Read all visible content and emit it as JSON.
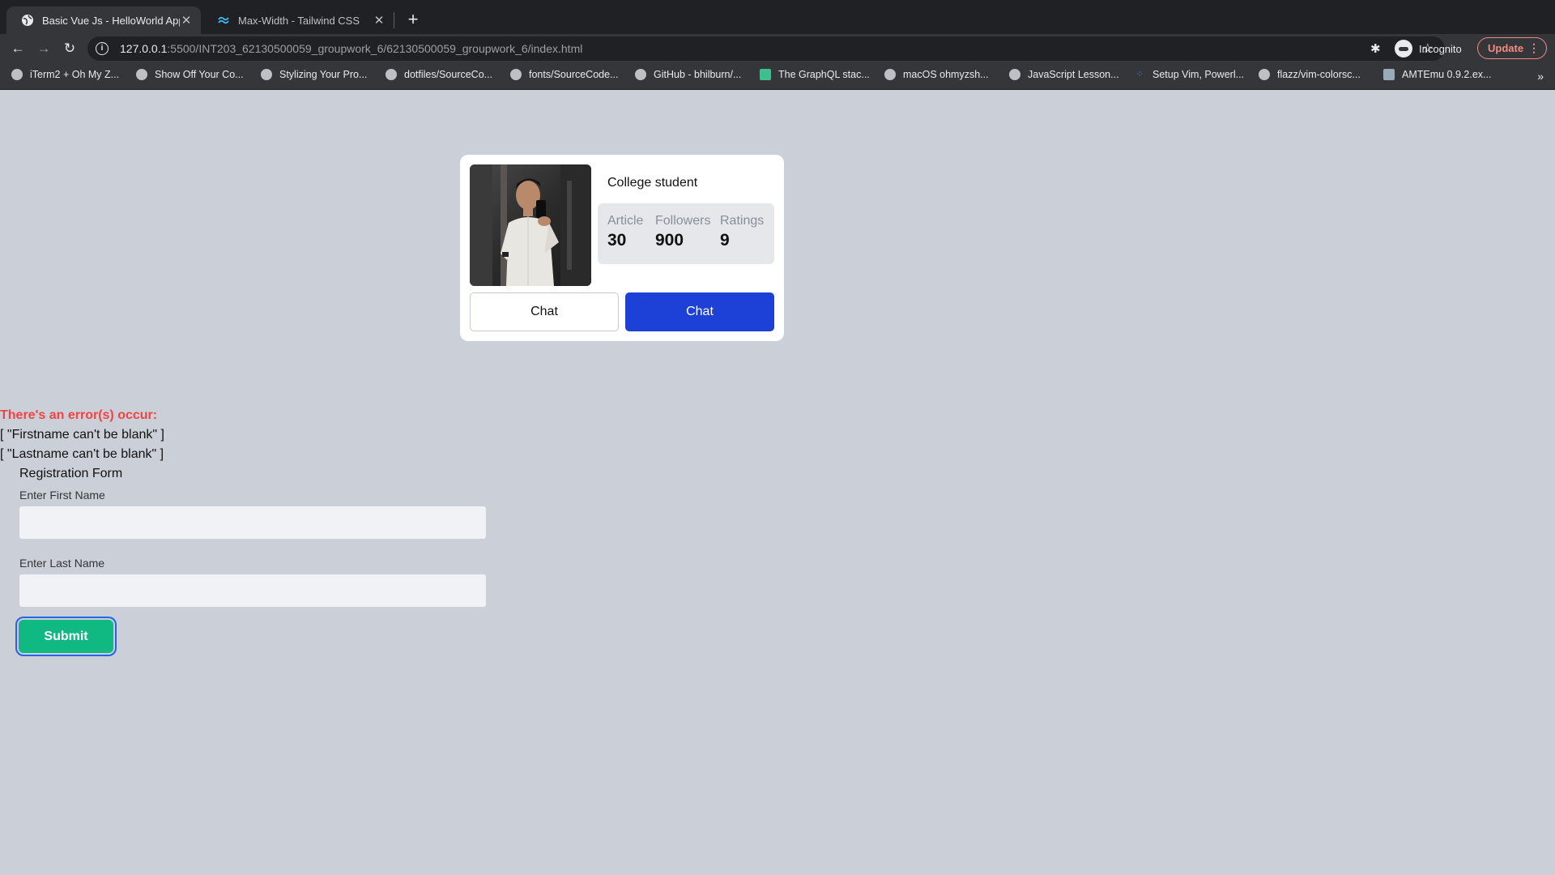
{
  "browser": {
    "tabs": [
      {
        "title": "Basic Vue Js - HelloWorld App",
        "active": true,
        "icon": "globe-icon"
      },
      {
        "title": "Max-Width - Tailwind CSS",
        "active": false,
        "icon": "tailwind-icon"
      }
    ],
    "url_host": "127.0.0.1",
    "url_rest": ":5500/INT203_62130500059_groupwork_6/62130500059_groupwork_6/index.html",
    "profile_label": "Incognito",
    "update_label": "Update",
    "bookmarks": [
      {
        "label": "iTerm2 + Oh My Z...",
        "icon": "github-icon"
      },
      {
        "label": "Show Off Your Co...",
        "icon": "github-icon"
      },
      {
        "label": "Stylizing Your Pro...",
        "icon": "github-icon"
      },
      {
        "label": "dotfiles/SourceCo...",
        "icon": "github-icon"
      },
      {
        "label": "fonts/SourceCode...",
        "icon": "github-icon"
      },
      {
        "label": "GitHub - bhilburn/...",
        "icon": "github-icon"
      },
      {
        "label": "The GraphQL stac...",
        "icon": "graphql-icon"
      },
      {
        "label": "macOS ohmyzsh...",
        "icon": "globe-icon"
      },
      {
        "label": "JavaScript Lesson...",
        "icon": "globe-icon"
      },
      {
        "label": "Setup Vim, Powerl...",
        "icon": "dots-icon"
      },
      {
        "label": "flazz/vim-colorsc...",
        "icon": "github-icon"
      },
      {
        "label": "AMTEmu 0.9.2.ex...",
        "icon": "image-icon"
      }
    ]
  },
  "profile_card": {
    "role": "College student",
    "stats": [
      {
        "label": "Article",
        "value": "30"
      },
      {
        "label": "Followers",
        "value": "900"
      },
      {
        "label": "Ratings",
        "value": "9"
      }
    ],
    "chat_outline_label": "Chat",
    "chat_solid_label": "Chat"
  },
  "errors": {
    "title": "There's an error(s) occur:",
    "items": [
      "[ \"Firstname can't be blank\" ]",
      "[ \"Lastname can't be blank\" ]"
    ]
  },
  "form": {
    "title": "Registration Form",
    "first_name_label": "Enter First Name",
    "first_name_value": "",
    "last_name_label": "Enter Last Name",
    "last_name_value": "",
    "submit_label": "Submit"
  },
  "colors": {
    "page_bg": "#cbd0d8",
    "error": "#ef4444",
    "primary_button": "#1d41d6",
    "submit_button": "#10b981"
  }
}
